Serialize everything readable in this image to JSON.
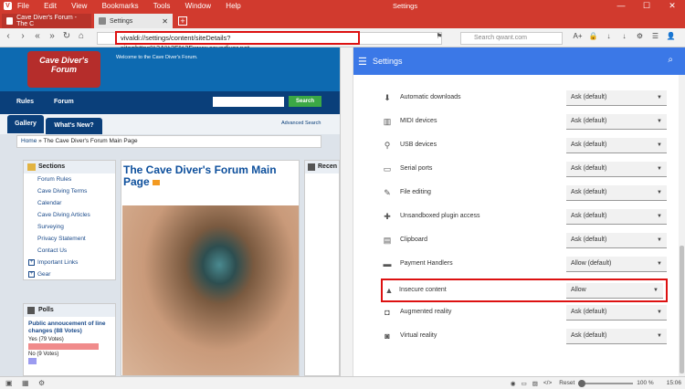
{
  "window": {
    "title": "Settings",
    "menu": [
      "File",
      "Edit",
      "View",
      "Bookmarks",
      "Tools",
      "Window",
      "Help"
    ],
    "controls": {
      "minimize": "—",
      "maximize": "☐",
      "close": "✕"
    }
  },
  "tabs": [
    {
      "label": "Cave Diver's Forum - The C",
      "close": "✕"
    },
    {
      "label": "Settings",
      "close": "✕"
    }
  ],
  "address": {
    "url": "vivaldi://settings/content/siteDetails?site=https%3A%2F%2Fwww.cavediver.net",
    "search_placeholder": "Search qwant.com"
  },
  "nav_icons": {
    "back": "‹",
    "forward": "›",
    "rewind": "«",
    "fastforward": "»",
    "reload": "↻",
    "home": "⌂",
    "bookmark": "⚑",
    "lock": "🛡"
  },
  "toolbar_icons": [
    "A+",
    "🔒",
    "↓",
    "↓",
    "⚙",
    "☰",
    "👤"
  ],
  "website": {
    "logo_text": "Cave Diver's Forum",
    "welcome": "Welcome to the Cave Diver's Forum.",
    "nav": [
      "Rules",
      "Forum"
    ],
    "search_button": "Search",
    "subnav": [
      "Gallery",
      "What's New?"
    ],
    "advanced_search": "Advanced Search",
    "breadcrumb": {
      "home": "Home",
      "sep": "»",
      "current": "The Cave Diver's Forum Main Page"
    },
    "sections_title": "Sections",
    "sections": [
      "Forum Rules",
      "Cave Diving Terms",
      "Calendar",
      "Cave Diving Articles",
      "Surveying",
      "Privacy Statement",
      "Contact Us"
    ],
    "sections_expand": [
      "Important Links",
      "Gear"
    ],
    "polls_title": "Polls",
    "poll_question": "Public annoucement of line changes (88 Votes)",
    "poll_options": [
      {
        "label": "Yes (79 Votes)",
        "fraction": 0.9
      },
      {
        "label": "No (9 Votes)",
        "fraction": 0.1
      }
    ],
    "main_title": "The Cave Diver's Forum Main Page",
    "recent_title": "Recen"
  },
  "settings": {
    "header": "Settings",
    "rows": [
      {
        "label": "Automatic downloads",
        "value": "Ask (default)",
        "icon": "download-icon",
        "glyph": "⬇"
      },
      {
        "label": "MIDI devices",
        "value": "Ask (default)",
        "icon": "midi-icon",
        "glyph": "▥"
      },
      {
        "label": "USB devices",
        "value": "Ask (default)",
        "icon": "usb-icon",
        "glyph": "⚲"
      },
      {
        "label": "Serial ports",
        "value": "Ask (default)",
        "icon": "serial-port-icon",
        "glyph": "▭"
      },
      {
        "label": "File editing",
        "value": "Ask (default)",
        "icon": "file-edit-icon",
        "glyph": "✎"
      },
      {
        "label": "Unsandboxed plugin access",
        "value": "Ask (default)",
        "icon": "puzzle-icon",
        "glyph": "✚"
      },
      {
        "label": "Clipboard",
        "value": "Ask (default)",
        "icon": "clipboard-icon",
        "glyph": "▤"
      },
      {
        "label": "Payment Handlers",
        "value": "Allow (default)",
        "icon": "card-icon",
        "glyph": "▬"
      },
      {
        "label": "Insecure content",
        "value": "Allow",
        "icon": "warning-icon",
        "glyph": "▲",
        "highlighted": true
      },
      {
        "label": "Augmented reality",
        "value": "Ask (default)",
        "icon": "ar-icon",
        "glyph": "◘"
      },
      {
        "label": "Virtual reality",
        "value": "Ask (default)",
        "icon": "vr-icon",
        "glyph": "◙"
      }
    ]
  },
  "statusbar": {
    "reset": "Reset",
    "zoom": "100 %",
    "time": "15:06"
  },
  "colors": {
    "brand": "#d13a2e",
    "settings_header": "#3b78e7",
    "highlight": "#dd1111"
  }
}
